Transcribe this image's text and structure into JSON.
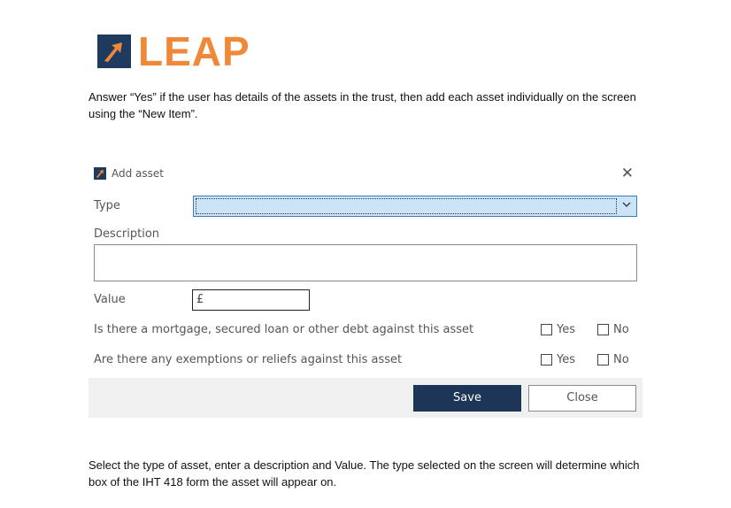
{
  "logo": {
    "text": "LEAP",
    "brand_color": "#f0883a",
    "mark_color": "#1f3a5f"
  },
  "intro_text": "Answer “Yes” if the user has details of the assets in the trust, then add each asset individually on the screen using the “New Item”.",
  "dialog": {
    "title": "Add asset",
    "close_icon": "✕",
    "type_label": "Type",
    "type_value": "",
    "description_label": "Description",
    "description_value": "",
    "value_label": "Value",
    "value_text": "£",
    "question_mortgage": "Is there a mortgage, secured loan or other debt against this asset",
    "question_exemptions": "Are there any exemptions or reliefs against this asset",
    "yes_label": "Yes",
    "no_label": "No",
    "save_label": "Save",
    "close_label": "Close",
    "accent_color": "#1d3557",
    "select_highlight": "#cce4f7"
  },
  "outro_text": "Select the type of asset, enter a description and Value. The type selected on the screen will determine which box of the IHT 418 form the asset will appear on."
}
